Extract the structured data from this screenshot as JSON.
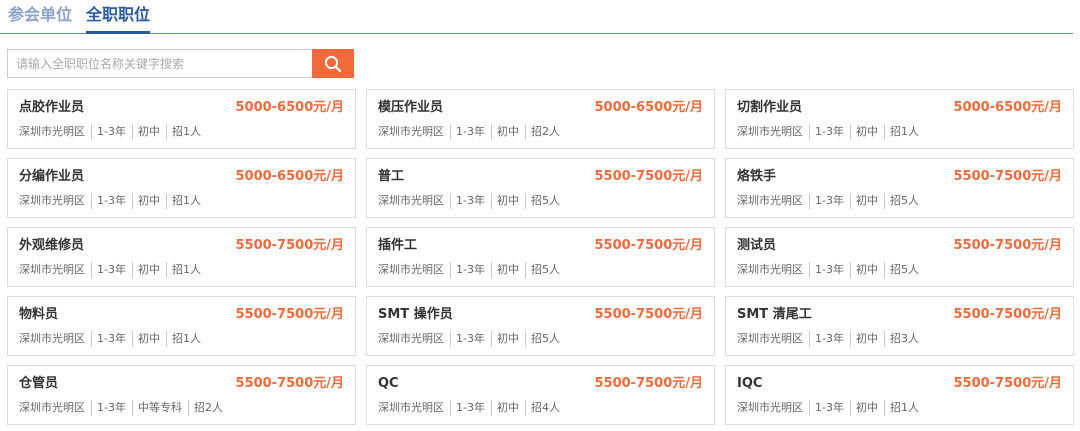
{
  "tabs": [
    {
      "label": "参会单位",
      "active": false
    },
    {
      "label": "全职职位",
      "active": true
    }
  ],
  "search": {
    "placeholder": "请输入全职职位名称关键字搜索",
    "value": "",
    "button_icon": "search-icon"
  },
  "colors": {
    "accent": "#f16a3c",
    "tab_active": "#2c5aa0",
    "tab_inactive": "#8aa2c8",
    "divider": "#5b88d6"
  },
  "jobs": [
    {
      "title": "点胶作业员",
      "salary": "5000-6500元/月",
      "location": "深圳市光明区",
      "experience": "1-3年",
      "education": "初中",
      "openings": "招1人"
    },
    {
      "title": "模压作业员",
      "salary": "5000-6500元/月",
      "location": "深圳市光明区",
      "experience": "1-3年",
      "education": "初中",
      "openings": "招2人"
    },
    {
      "title": "切割作业员",
      "salary": "5000-6500元/月",
      "location": "深圳市光明区",
      "experience": "1-3年",
      "education": "初中",
      "openings": "招1人"
    },
    {
      "title": "分编作业员",
      "salary": "5000-6500元/月",
      "location": "深圳市光明区",
      "experience": "1-3年",
      "education": "初中",
      "openings": "招1人"
    },
    {
      "title": "普工",
      "salary": "5500-7500元/月",
      "location": "深圳市光明区",
      "experience": "1-3年",
      "education": "初中",
      "openings": "招5人"
    },
    {
      "title": "烙铁手",
      "salary": "5500-7500元/月",
      "location": "深圳市光明区",
      "experience": "1-3年",
      "education": "初中",
      "openings": "招5人"
    },
    {
      "title": "外观维修员",
      "salary": "5500-7500元/月",
      "location": "深圳市光明区",
      "experience": "1-3年",
      "education": "初中",
      "openings": "招1人"
    },
    {
      "title": "插件工",
      "salary": "5500-7500元/月",
      "location": "深圳市光明区",
      "experience": "1-3年",
      "education": "初中",
      "openings": "招5人"
    },
    {
      "title": "测试员",
      "salary": "5500-7500元/月",
      "location": "深圳市光明区",
      "experience": "1-3年",
      "education": "初中",
      "openings": "招5人"
    },
    {
      "title": "物料员",
      "salary": "5500-7500元/月",
      "location": "深圳市光明区",
      "experience": "1-3年",
      "education": "初中",
      "openings": "招1人"
    },
    {
      "title": "SMT 操作员",
      "salary": "5500-7500元/月",
      "location": "深圳市光明区",
      "experience": "1-3年",
      "education": "初中",
      "openings": "招5人"
    },
    {
      "title": "SMT 清尾工",
      "salary": "5500-7500元/月",
      "location": "深圳市光明区",
      "experience": "1-3年",
      "education": "初中",
      "openings": "招3人"
    },
    {
      "title": "仓管员",
      "salary": "5500-7500元/月",
      "location": "深圳市光明区",
      "experience": "1-3年",
      "education": "中等专科",
      "openings": "招2人"
    },
    {
      "title": "QC",
      "salary": "5500-7500元/月",
      "location": "深圳市光明区",
      "experience": "1-3年",
      "education": "初中",
      "openings": "招4人"
    },
    {
      "title": "IQC",
      "salary": "5500-7500元/月",
      "location": "深圳市光明区",
      "experience": "1-3年",
      "education": "初中",
      "openings": "招1人"
    }
  ]
}
